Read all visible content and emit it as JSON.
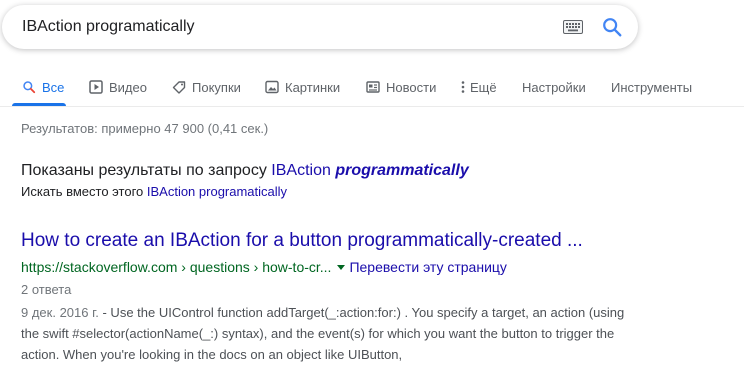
{
  "search": {
    "query": "IBAction programatically"
  },
  "tabs": [
    {
      "label": "Все",
      "icon": "search-icon",
      "active": true
    },
    {
      "label": "Видео",
      "icon": "play-icon"
    },
    {
      "label": "Покупки",
      "icon": "tag-icon"
    },
    {
      "label": "Картинки",
      "icon": "image-icon"
    },
    {
      "label": "Новости",
      "icon": "news-icon"
    },
    {
      "label": "Ещё",
      "icon": "more-vert-icon"
    },
    {
      "label": "Настройки"
    },
    {
      "label": "Инструменты"
    }
  ],
  "stats": "Результатов: примерно 47 900 (0,41 сек.)",
  "spelling": {
    "showing_prefix": "Показаны результаты по запросу",
    "showing_word": "IBAction",
    "showing_emph": "programmatically",
    "instead_prefix": "Искать вместо этого",
    "instead_link": "IBAction programatically"
  },
  "result": {
    "title": "How to create an IBAction for a button programmatically-created ...",
    "url": "https://stackoverflow.com › questions › how-to-cr...",
    "translate": "Перевести эту страницу",
    "answers": "2 ответа",
    "date": "9 дек. 2016 г.",
    "snippet": " - Use the UIControl function addTarget(_:action:for:) . You specify a target, an action (using the swift #selector(actionName(_:) syntax), and the event(s) for which you want the button to trigger the action. When you're looking in the docs on an object like UIButton,"
  },
  "colors": {
    "accent": "#1a73e8",
    "link": "#1a0dab",
    "url": "#006621"
  }
}
